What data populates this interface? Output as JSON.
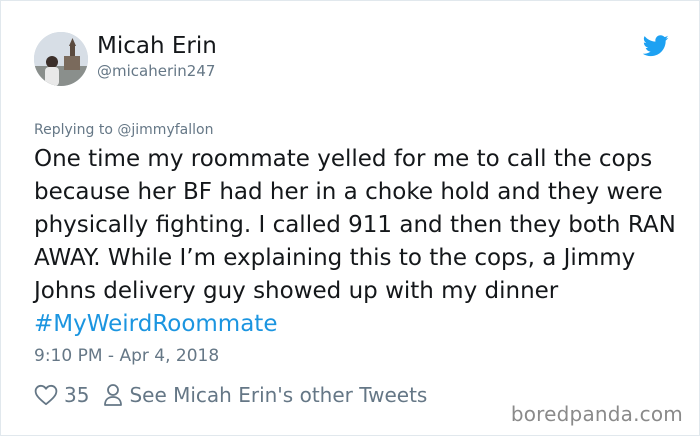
{
  "user": {
    "display_name": "Micah Erin",
    "handle": "@micaherin247"
  },
  "reply": {
    "prefix": "Replying to ",
    "mention": "@jimmyfallon"
  },
  "tweet": {
    "text": "One time my roommate yelled for me to call the cops because her BF had her in a choke hold and they were physically fighting. I called 911 and then they both RAN AWAY. While I’m explaining this to the cops, a Jimmy Johns delivery guy showed up with my dinner ",
    "hashtag": "#MyWeirdRoommate",
    "timestamp": "9:10 PM - Apr 4, 2018"
  },
  "actions": {
    "like_count": "35",
    "other_tweets_label": "See Micah Erin's other Tweets"
  },
  "watermark": "boredpanda.com",
  "icons": {
    "brand": "twitter-bird-icon",
    "like": "heart-icon",
    "profile": "person-icon"
  },
  "colors": {
    "twitter_blue": "#1da1f2",
    "hashtag": "#1b95e0",
    "secondary_text": "#657786",
    "primary_text": "#14171a"
  }
}
